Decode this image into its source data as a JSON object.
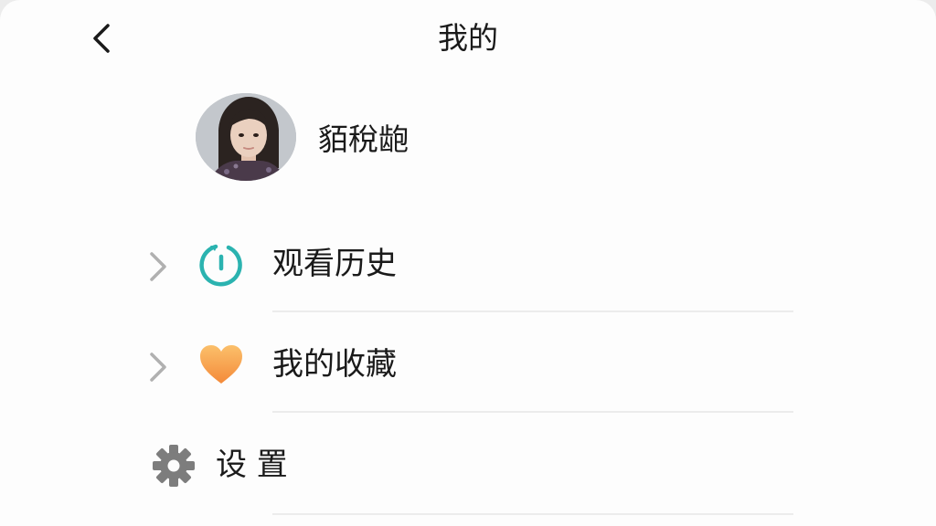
{
  "header": {
    "title": "我的"
  },
  "profile": {
    "username": "貊稅龅"
  },
  "menu": {
    "history_label": "观看历史",
    "favorites_label": "我的收藏",
    "settings_label": "设 置"
  },
  "colors": {
    "history_icon": "#2bb3b0",
    "favorites_icon": "#f5a04a",
    "settings_icon": "#7d7d7d",
    "chevron": "#b0b0b0"
  }
}
